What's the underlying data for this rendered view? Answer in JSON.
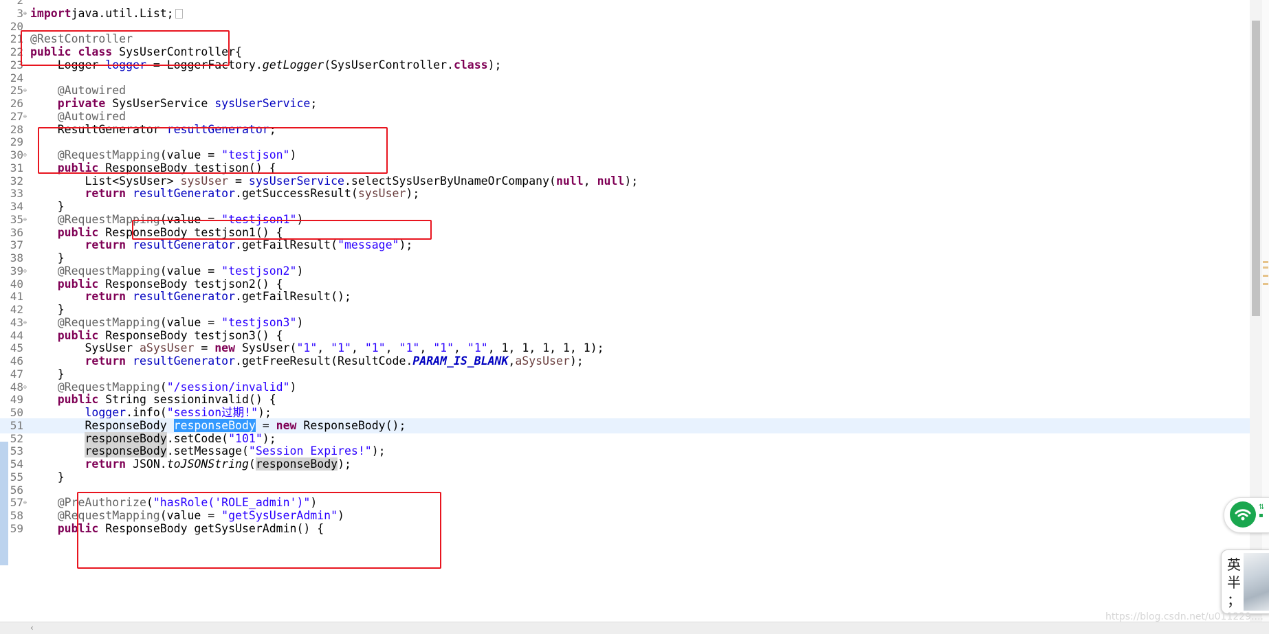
{
  "editor": {
    "lines": [
      {
        "n": "2",
        "fold": "",
        "tokens": []
      },
      {
        "n": "3",
        "fold": "⊕",
        "tokens": [
          [
            "kw",
            "import"
          ],
          [
            "",
            "java.util.List;"
          ]
        ],
        "folded": true
      },
      {
        "n": "20",
        "fold": "",
        "tokens": []
      },
      {
        "n": "21",
        "fold": "",
        "tokens": [
          [
            "ann",
            "@RestController"
          ]
        ]
      },
      {
        "n": "22",
        "fold": "",
        "tokens": [
          [
            "kw",
            "public"
          ],
          [
            "",
            " "
          ],
          [
            "kw",
            "class"
          ],
          [
            "",
            " SysUserController{"
          ]
        ]
      },
      {
        "n": "23",
        "fold": "",
        "tokens": [
          [
            "",
            "    Logger "
          ],
          [
            "fld",
            "logger"
          ],
          [
            "",
            " = LoggerFactory."
          ],
          [
            "mth",
            "getLogger"
          ],
          [
            "",
            "(SysUserController."
          ],
          [
            "kw",
            "class"
          ],
          [
            "",
            ");"
          ]
        ]
      },
      {
        "n": "24",
        "fold": "",
        "tokens": []
      },
      {
        "n": "25",
        "fold": "⊖",
        "tokens": [
          [
            "ann",
            "    @Autowired"
          ]
        ]
      },
      {
        "n": "26",
        "fold": "",
        "tokens": [
          [
            "",
            "    "
          ],
          [
            "kw",
            "private"
          ],
          [
            "",
            " SysUserService "
          ],
          [
            "fld",
            "sysUserService"
          ],
          [
            "",
            ";"
          ]
        ]
      },
      {
        "n": "27",
        "fold": "⊖",
        "tokens": [
          [
            "ann",
            "    @Autowired"
          ]
        ]
      },
      {
        "n": "28",
        "fold": "",
        "tokens": [
          [
            "",
            "    ResultGenerator "
          ],
          [
            "fld",
            "resultGenerator"
          ],
          [
            "",
            ";"
          ]
        ]
      },
      {
        "n": "29",
        "fold": "",
        "tokens": []
      },
      {
        "n": "30",
        "fold": "⊖",
        "tokens": [
          [
            "ann",
            "    @RequestMapping"
          ],
          [
            "",
            "(value = "
          ],
          [
            "str",
            "\"testjson\""
          ],
          [
            "",
            ")"
          ]
        ]
      },
      {
        "n": "31",
        "fold": "",
        "tokens": [
          [
            "",
            "    "
          ],
          [
            "kw",
            "public"
          ],
          [
            "",
            " ResponseBody testjson() {"
          ]
        ]
      },
      {
        "n": "32",
        "fold": "",
        "tokens": [
          [
            "",
            "        List<SysUser> "
          ],
          [
            "loc",
            "sysUser"
          ],
          [
            "",
            " = "
          ],
          [
            "fld",
            "sysUserService"
          ],
          [
            "",
            ".selectSysUserByUnameOrCompany("
          ],
          [
            "kw",
            "null"
          ],
          [
            "",
            ", "
          ],
          [
            "kw",
            "null"
          ],
          [
            "",
            ");"
          ]
        ]
      },
      {
        "n": "33",
        "fold": "",
        "tokens": [
          [
            "",
            "        "
          ],
          [
            "kw",
            "return"
          ],
          [
            "",
            " "
          ],
          [
            "fld",
            "resultGenerator"
          ],
          [
            "",
            ".getSuccessResult("
          ],
          [
            "loc",
            "sysUser"
          ],
          [
            "",
            ");"
          ]
        ]
      },
      {
        "n": "34",
        "fold": "",
        "tokens": [
          [
            "",
            "    }"
          ]
        ]
      },
      {
        "n": "35",
        "fold": "⊖",
        "tokens": [
          [
            "ann",
            "    @RequestMapping"
          ],
          [
            "",
            "(value = "
          ],
          [
            "str",
            "\"testjson1\""
          ],
          [
            "",
            ")"
          ]
        ]
      },
      {
        "n": "36",
        "fold": "",
        "tokens": [
          [
            "",
            "    "
          ],
          [
            "kw",
            "public"
          ],
          [
            "",
            " ResponseBody testjson1() {"
          ]
        ]
      },
      {
        "n": "37",
        "fold": "",
        "tokens": [
          [
            "",
            "        "
          ],
          [
            "kw",
            "return"
          ],
          [
            "",
            " "
          ],
          [
            "fld",
            "resultGenerator"
          ],
          [
            "",
            ".getFailResult("
          ],
          [
            "str",
            "\"message\""
          ],
          [
            "",
            ");"
          ]
        ]
      },
      {
        "n": "38",
        "fold": "",
        "tokens": [
          [
            "",
            "    }"
          ]
        ]
      },
      {
        "n": "39",
        "fold": "⊖",
        "tokens": [
          [
            "ann",
            "    @RequestMapping"
          ],
          [
            "",
            "(value = "
          ],
          [
            "str",
            "\"testjson2\""
          ],
          [
            "",
            ")"
          ]
        ]
      },
      {
        "n": "40",
        "fold": "",
        "tokens": [
          [
            "",
            "    "
          ],
          [
            "kw",
            "public"
          ],
          [
            "",
            " ResponseBody testjson2() {"
          ]
        ]
      },
      {
        "n": "41",
        "fold": "",
        "tokens": [
          [
            "",
            "        "
          ],
          [
            "kw",
            "return"
          ],
          [
            "",
            " "
          ],
          [
            "fld",
            "resultGenerator"
          ],
          [
            "",
            ".getFailResult();"
          ]
        ]
      },
      {
        "n": "42",
        "fold": "",
        "tokens": [
          [
            "",
            "    }"
          ]
        ]
      },
      {
        "n": "43",
        "fold": "⊖",
        "tokens": [
          [
            "ann",
            "    @RequestMapping"
          ],
          [
            "",
            "(value = "
          ],
          [
            "str",
            "\"testjson3\""
          ],
          [
            "",
            ")"
          ]
        ]
      },
      {
        "n": "44",
        "fold": "",
        "tokens": [
          [
            "",
            "    "
          ],
          [
            "kw",
            "public"
          ],
          [
            "",
            " ResponseBody testjson3() {"
          ]
        ]
      },
      {
        "n": "45",
        "fold": "",
        "tokens": [
          [
            "",
            "        SysUser "
          ],
          [
            "loc",
            "aSysUser"
          ],
          [
            "",
            " = "
          ],
          [
            "kw",
            "new"
          ],
          [
            "",
            " SysUser("
          ],
          [
            "str",
            "\"1\""
          ],
          [
            "",
            ", "
          ],
          [
            "str",
            "\"1\""
          ],
          [
            "",
            ", "
          ],
          [
            "str",
            "\"1\""
          ],
          [
            "",
            ", "
          ],
          [
            "str",
            "\"1\""
          ],
          [
            "",
            ", "
          ],
          [
            "str",
            "\"1\""
          ],
          [
            "",
            ", "
          ],
          [
            "str",
            "\"1\""
          ],
          [
            "",
            ", 1, 1, 1, 1, 1);"
          ]
        ]
      },
      {
        "n": "46",
        "fold": "",
        "tokens": [
          [
            "",
            "        "
          ],
          [
            "kw",
            "return"
          ],
          [
            "",
            " "
          ],
          [
            "fld",
            "resultGenerator"
          ],
          [
            "",
            ".getFreeResult(ResultCode."
          ],
          [
            "sfld",
            "PARAM_IS_BLANK"
          ],
          [
            "",
            ","
          ],
          [
            "loc",
            "aSysUser"
          ],
          [
            "",
            ");"
          ]
        ]
      },
      {
        "n": "47",
        "fold": "",
        "tokens": [
          [
            "",
            "    }"
          ]
        ]
      },
      {
        "n": "48",
        "fold": "⊖",
        "tokens": [
          [
            "ann",
            "    @RequestMapping"
          ],
          [
            "",
            "("
          ],
          [
            "str",
            "\"/session/invalid\""
          ],
          [
            "",
            ")"
          ]
        ]
      },
      {
        "n": "49",
        "fold": "",
        "tokens": [
          [
            "",
            "    "
          ],
          [
            "kw",
            "public"
          ],
          [
            "",
            " String sessioninvalid() {"
          ]
        ]
      },
      {
        "n": "50",
        "fold": "",
        "tokens": [
          [
            "",
            "        "
          ],
          [
            "fld",
            "logger"
          ],
          [
            "",
            ".info("
          ],
          [
            "str",
            "\"session过期!\""
          ],
          [
            "",
            ");"
          ]
        ]
      },
      {
        "n": "51",
        "fold": "",
        "current": true,
        "tokens": [
          [
            "",
            "        ResponseBody "
          ],
          [
            "sel",
            "responseBody"
          ],
          [
            "",
            " = "
          ],
          [
            "kw",
            "new"
          ],
          [
            "",
            " ResponseBody();"
          ]
        ]
      },
      {
        "n": "52",
        "fold": "",
        "tokens": [
          [
            "",
            "        "
          ],
          [
            "occ",
            "responseBody"
          ],
          [
            "",
            ".setCode("
          ],
          [
            "str",
            "\"101\""
          ],
          [
            "",
            ");"
          ]
        ]
      },
      {
        "n": "53",
        "fold": "",
        "tokens": [
          [
            "",
            "        "
          ],
          [
            "occ",
            "responseBody"
          ],
          [
            "",
            ".setMessage("
          ],
          [
            "str",
            "\"Session Expires!\""
          ],
          [
            "",
            ");"
          ]
        ]
      },
      {
        "n": "54",
        "fold": "",
        "tokens": [
          [
            "",
            "        "
          ],
          [
            "kw",
            "return"
          ],
          [
            "",
            " JSON."
          ],
          [
            "mth",
            "toJSONString"
          ],
          [
            "",
            "("
          ],
          [
            "occ",
            "responseBody"
          ],
          [
            "",
            ");"
          ]
        ]
      },
      {
        "n": "55",
        "fold": "",
        "tokens": [
          [
            "",
            "    }"
          ]
        ]
      },
      {
        "n": "56",
        "fold": "",
        "tokens": []
      },
      {
        "n": "57",
        "fold": "⊖",
        "tokens": [
          [
            "ann",
            "    @PreAuthorize"
          ],
          [
            "",
            "("
          ],
          [
            "str",
            "\"hasRole('ROLE_admin')\""
          ],
          [
            "",
            ")"
          ]
        ]
      },
      {
        "n": "58",
        "fold": "",
        "tokens": [
          [
            "ann",
            "    @RequestMapping"
          ],
          [
            "",
            "(value = "
          ],
          [
            "str",
            "\"getSysUserAdmin\""
          ],
          [
            "",
            ")"
          ]
        ]
      },
      {
        "n": "59",
        "fold": "",
        "tokens": [
          [
            "",
            "    "
          ],
          [
            "kw",
            "public"
          ],
          [
            "",
            " ResponseBody getSysUserAdmin() {"
          ]
        ]
      }
    ]
  },
  "colors": {
    "keyword": "#7f0055",
    "annotation": "#646464",
    "string": "#2a00ff",
    "field": "#0000c0",
    "local": "#6a3e3e",
    "highlight_box": "#e8141e",
    "selection": "#3399ff"
  },
  "widgets": {
    "wifi_icon": "wifi-icon",
    "ime_text": "英\n半\n；"
  },
  "watermark": "https://blog.csdn.net/u011229...."
}
